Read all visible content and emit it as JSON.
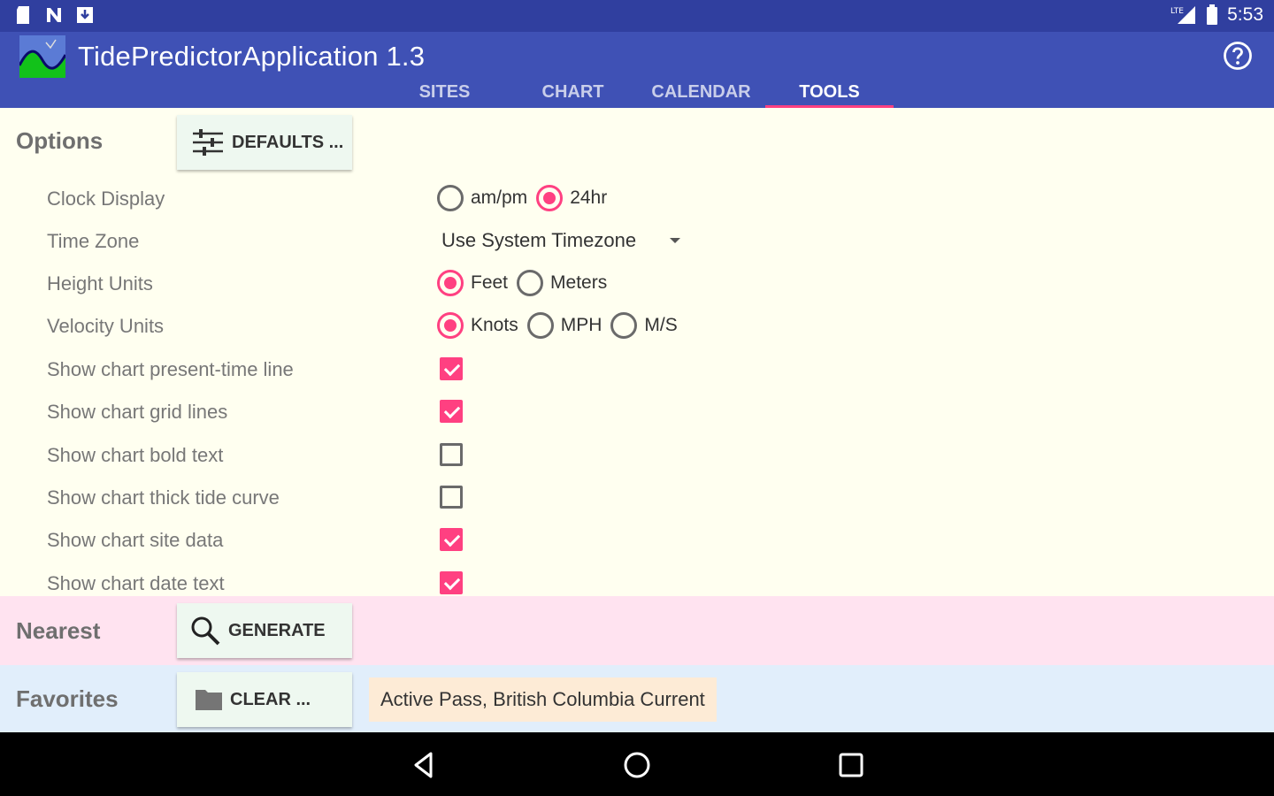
{
  "status_bar": {
    "time": "5:53",
    "network_label": "LTE"
  },
  "app": {
    "title": "TidePredictorApplication 1.3"
  },
  "tabs": [
    {
      "label": "SITES"
    },
    {
      "label": "CHART"
    },
    {
      "label": "CALENDAR"
    },
    {
      "label": "TOOLS",
      "active": true
    }
  ],
  "options": {
    "section_label": "Options",
    "defaults_button": "DEFAULTS ...",
    "clock_display": {
      "label": "Clock Display",
      "opt1": "am/pm",
      "opt2": "24hr",
      "selected": "24hr"
    },
    "time_zone": {
      "label": "Time Zone",
      "value": "Use System Timezone"
    },
    "height_units": {
      "label": "Height Units",
      "opt1": "Feet",
      "opt2": "Meters",
      "selected": "Feet"
    },
    "velocity_units": {
      "label": "Velocity Units",
      "opt1": "Knots",
      "opt2": "MPH",
      "opt3": "M/S",
      "selected": "Knots"
    },
    "checkboxes": [
      {
        "label": "Show chart present-time line",
        "checked": true
      },
      {
        "label": "Show chart grid lines",
        "checked": true
      },
      {
        "label": "Show chart bold text",
        "checked": false
      },
      {
        "label": "Show chart thick tide curve",
        "checked": false
      },
      {
        "label": "Show chart site data",
        "checked": true
      },
      {
        "label": "Show chart date text",
        "checked": true
      }
    ]
  },
  "nearest": {
    "section_label": "Nearest",
    "button": "GENERATE"
  },
  "favorites": {
    "section_label": "Favorites",
    "button": "CLEAR ...",
    "item": "Active Pass, British Columbia Current"
  },
  "colors": {
    "primary": "#3f51b5",
    "primary_dark": "#303f9f",
    "accent": "#ff4081",
    "options_bg": "#fffff0",
    "nearest_bg": "#ffe3f0",
    "favorites_bg": "#e1eefb"
  }
}
